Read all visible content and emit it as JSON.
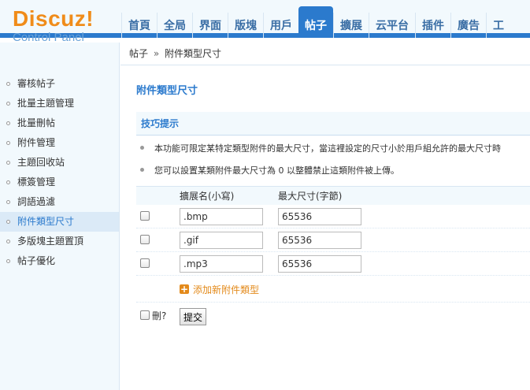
{
  "logo": {
    "main": "Discuz!",
    "sub": "Control Panel"
  },
  "nav": {
    "tabs": [
      {
        "label": "首頁"
      },
      {
        "label": "全局"
      },
      {
        "label": "界面"
      },
      {
        "label": "版塊"
      },
      {
        "label": "用戶"
      },
      {
        "label": "帖子",
        "active": true
      },
      {
        "label": "擴展"
      },
      {
        "label": "云平台"
      },
      {
        "label": "插件"
      },
      {
        "label": "廣告"
      },
      {
        "label": "工"
      }
    ]
  },
  "breadcrumb": {
    "parent": "帖子",
    "separator": "»",
    "current": "附件類型尺寸"
  },
  "sidebar": {
    "items": [
      {
        "label": "審核帖子"
      },
      {
        "label": "批量主題管理"
      },
      {
        "label": "批量刪帖"
      },
      {
        "label": "附件管理"
      },
      {
        "label": "主題回收站"
      },
      {
        "label": "標簽管理"
      },
      {
        "label": "詞語過濾"
      },
      {
        "label": "附件類型尺寸",
        "active": true
      },
      {
        "label": "多版塊主題置頂"
      },
      {
        "label": "帖子優化"
      }
    ]
  },
  "main": {
    "title": "附件類型尺寸",
    "tips_title": "技巧提示",
    "tips": [
      "本功能可限定某特定類型附件的最大尺寸，當這裡設定的尺寸小於用戶組允許的最大尺寸時",
      "您可以設置某類附件最大尺寸為 0 以整體禁止這類附件被上傳。"
    ],
    "table": {
      "col_ext": "擴展名(小寫)",
      "col_size": "最大尺寸(字節)",
      "rows": [
        {
          "ext": ".bmp",
          "size": "65536"
        },
        {
          "ext": ".gif",
          "size": "65536"
        },
        {
          "ext": ".mp3",
          "size": "65536"
        }
      ],
      "add_label": "添加新附件類型",
      "delete_label": "刪?",
      "submit_label": "提交"
    }
  },
  "colors": {
    "accent": "#2b7acd",
    "logo_orange": "#f08c1a",
    "add_orange": "#e38a1b",
    "panel_bg": "#f2f9fd"
  }
}
